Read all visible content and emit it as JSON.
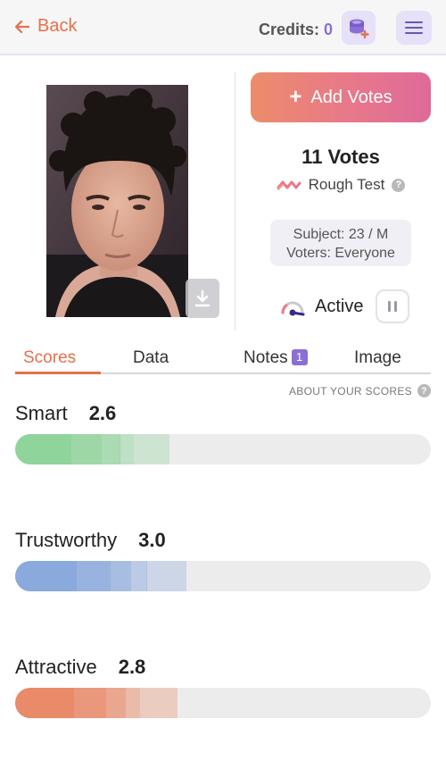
{
  "header": {
    "back_label": "Back",
    "credits_label": "Credits:",
    "credits_value": "0",
    "coins_icon": "coins-add-icon",
    "menu_icon": "hamburger-menu-icon"
  },
  "photo": {
    "download_icon": "download-icon"
  },
  "panel": {
    "add_votes_label": "Add Votes",
    "votes_count": "11 Votes",
    "test_type": "Rough Test",
    "subject": "Subject: 23 / M",
    "voters": "Voters: Everyone",
    "status": "Active"
  },
  "tabs": [
    {
      "label": "Scores",
      "active": true
    },
    {
      "label": "Data",
      "active": false
    },
    {
      "label": "Notes",
      "badge": "1",
      "active": false
    },
    {
      "label": "Image",
      "active": false
    }
  ],
  "about_label": "ABOUT YOUR SCORES",
  "scores": [
    {
      "name": "Smart",
      "value": "2.6",
      "fill_fraction": 0.37,
      "color": "#8fd49b"
    },
    {
      "name": "Trustworthy",
      "value": "3.0",
      "fill_fraction": 0.41,
      "color": "#8aa9dd"
    },
    {
      "name": "Attractive",
      "value": "2.8",
      "fill_fraction": 0.39,
      "color": "#e98a68"
    }
  ],
  "colors": {
    "accent": "#e86f4b",
    "purple": "#8b6fd6"
  }
}
